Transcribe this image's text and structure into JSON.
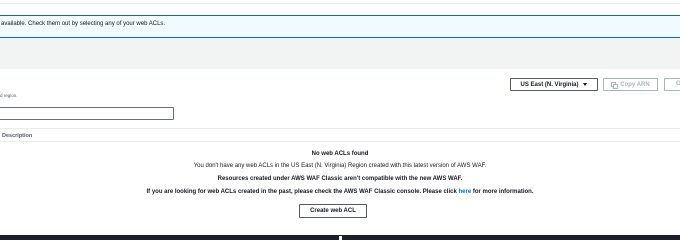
{
  "banner": {
    "text": "available. Check them out by selecting any of your web ACLs."
  },
  "toolbar": {
    "region_label": "US East (N. Virginia)",
    "copy_arn_label": "Copy ARN",
    "go_label": "Go"
  },
  "filter": {
    "hint": "d region.",
    "search_value": "",
    "search_placeholder": ""
  },
  "table": {
    "columns": [
      "Description"
    ]
  },
  "empty_state": {
    "title": "No web ACLs found",
    "line1": "You don't have any web ACLs in the US East (N. Virginia) Region created with this latest version of AWS WAF.",
    "line2": "Resources created under AWS WAF Classic aren't compatible with the new AWS WAF.",
    "line3_prefix": "If you are looking for web ACLs created in the past, please check the AWS WAF Classic console. Please click ",
    "line3_link": "here",
    "line3_suffix": " for more information.",
    "create_button": "Create web ACL"
  },
  "icons": {
    "region_dropdown": "caret-down-icon",
    "copy": "copy-icon"
  },
  "colors": {
    "accent": "#0073bb",
    "banner_bg": "#f1faff",
    "disabled": "#aab7b8"
  }
}
